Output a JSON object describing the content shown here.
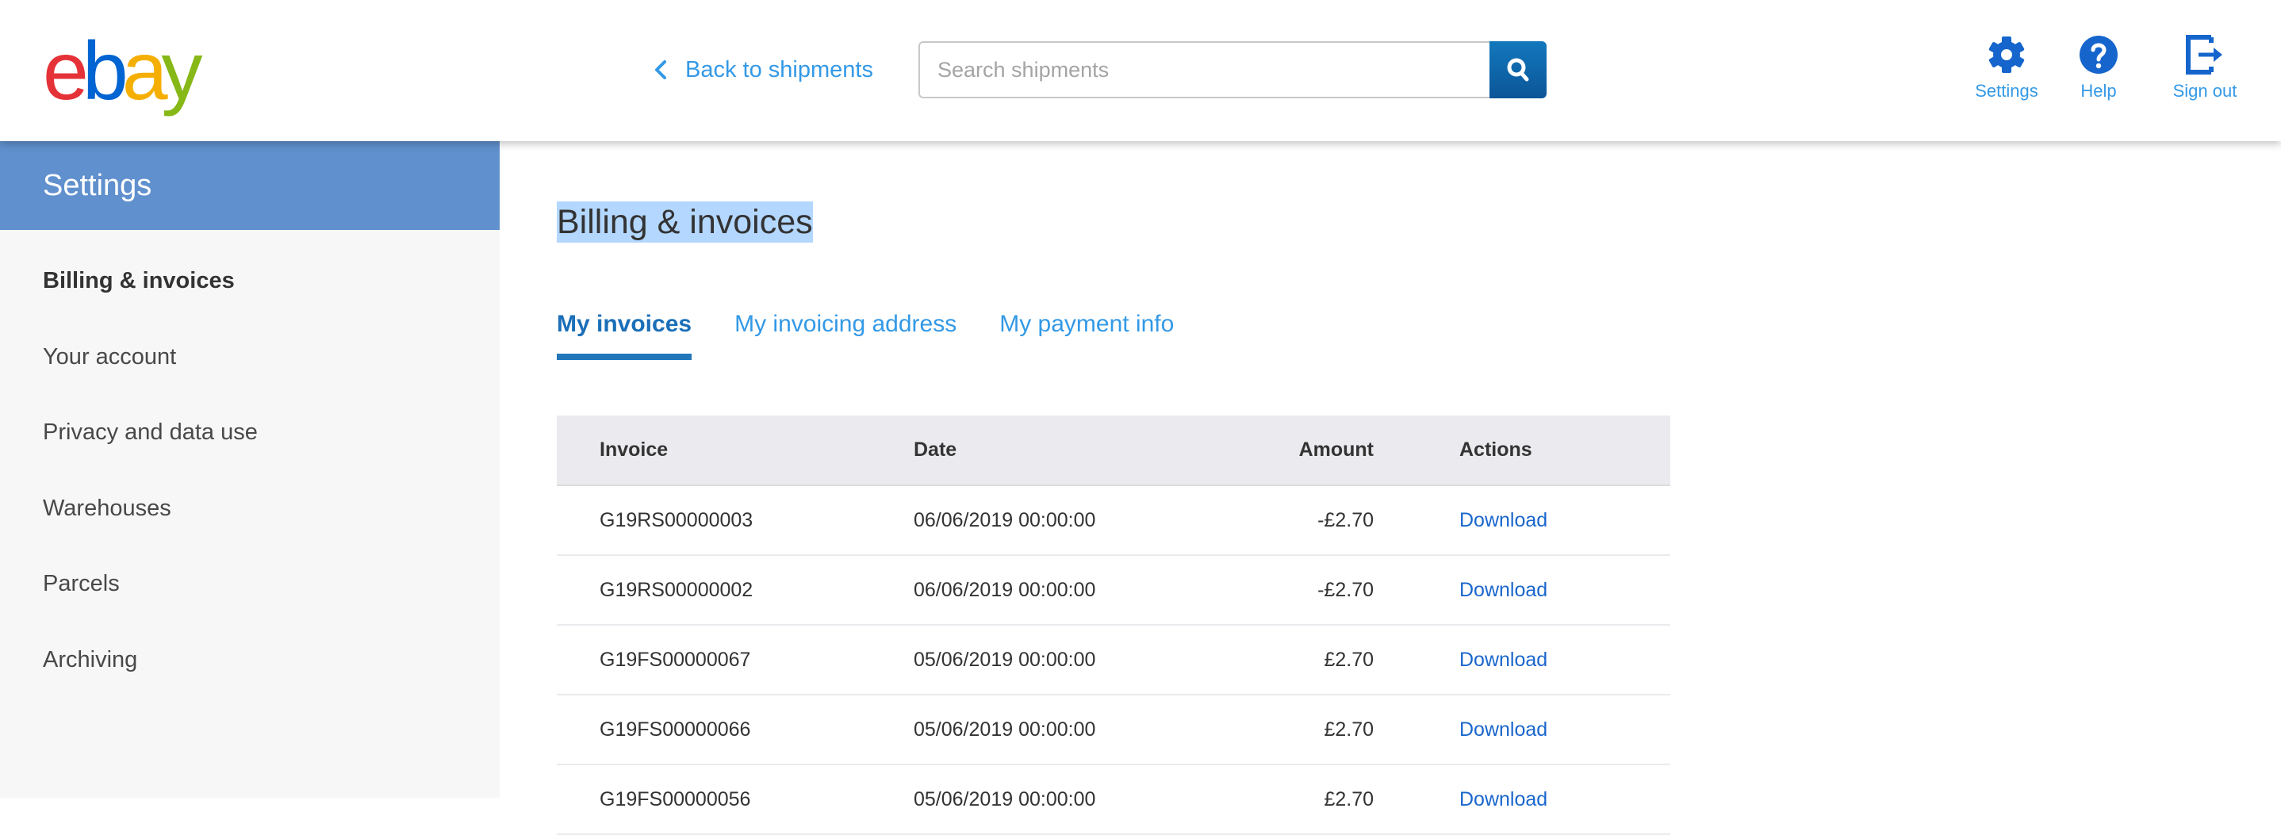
{
  "header": {
    "logo": {
      "letters": [
        {
          "char": "e",
          "color": "#e53238"
        },
        {
          "char": "b",
          "color": "#0064d2"
        },
        {
          "char": "a",
          "color": "#f5af02"
        },
        {
          "char": "y",
          "color": "#86b817"
        }
      ]
    },
    "back_link": {
      "label": "Back to shipments",
      "icon": "chevron-left-icon"
    },
    "search": {
      "placeholder": "Search shipments",
      "value": "",
      "button_icon": "search-icon"
    },
    "nav": [
      {
        "label": "Settings",
        "icon": "gear-icon"
      },
      {
        "label": "Help",
        "icon": "help-circle-icon"
      },
      {
        "label": "Sign out",
        "icon": "sign-out-icon"
      }
    ]
  },
  "sidebar": {
    "title": "Settings",
    "items": [
      {
        "label": "Billing & invoices",
        "active": true
      },
      {
        "label": "Your account",
        "active": false
      },
      {
        "label": "Privacy and data use",
        "active": false
      },
      {
        "label": "Warehouses",
        "active": false
      },
      {
        "label": "Parcels",
        "active": false
      },
      {
        "label": "Archiving",
        "active": false
      }
    ]
  },
  "main": {
    "title": "Billing & invoices",
    "tabs": [
      {
        "label": "My invoices",
        "active": true
      },
      {
        "label": "My invoicing address",
        "active": false
      },
      {
        "label": "My payment info",
        "active": false
      }
    ],
    "table": {
      "columns": [
        "Invoice",
        "Date",
        "Amount",
        "Actions"
      ],
      "rows": [
        {
          "invoice": "G19RS00000003",
          "date": "06/06/2019 00:00:00",
          "amount": "-£2.70",
          "action": "Download"
        },
        {
          "invoice": "G19RS00000002",
          "date": "06/06/2019 00:00:00",
          "amount": "-£2.70",
          "action": "Download"
        },
        {
          "invoice": "G19FS00000067",
          "date": "05/06/2019 00:00:00",
          "amount": "£2.70",
          "action": "Download"
        },
        {
          "invoice": "G19FS00000066",
          "date": "05/06/2019 00:00:00",
          "amount": "£2.70",
          "action": "Download"
        },
        {
          "invoice": "G19FS00000056",
          "date": "05/06/2019 00:00:00",
          "amount": "£2.70",
          "action": "Download"
        }
      ]
    }
  },
  "colors": {
    "brand_blue": "#3399e6",
    "icon_blue": "#1565cc",
    "link_blue": "#1a66cc",
    "sidebar_header": "#6090cd",
    "selection_highlight": "#b3d7ff"
  }
}
